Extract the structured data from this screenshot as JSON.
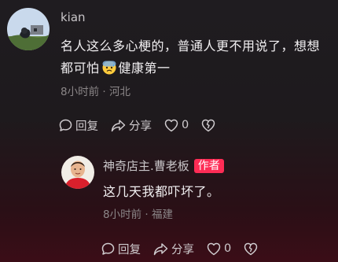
{
  "comments": [
    {
      "author": "kian",
      "text_part1": "名人这么多心梗的，普通人更不用说了，想想都可怕",
      "text_emoji": "anxious-face-with-sweat-emoji",
      "text_part2": "健康第一",
      "time": "8小时前",
      "location": "河北",
      "reply_label": "回复",
      "share_label": "分享",
      "like_count": "0"
    },
    {
      "author": "神奇店主.曹老板",
      "badge": "作者",
      "text": "这几天我都吓坏了。",
      "time": "8小时前",
      "location": "福建",
      "reply_label": "回复",
      "share_label": "分享",
      "like_count": "0"
    }
  ],
  "meta_separator": "·",
  "colors": {
    "badge": "#fe2c55",
    "meta_text": "#8c8789",
    "author_text": "#c9c6c9"
  }
}
